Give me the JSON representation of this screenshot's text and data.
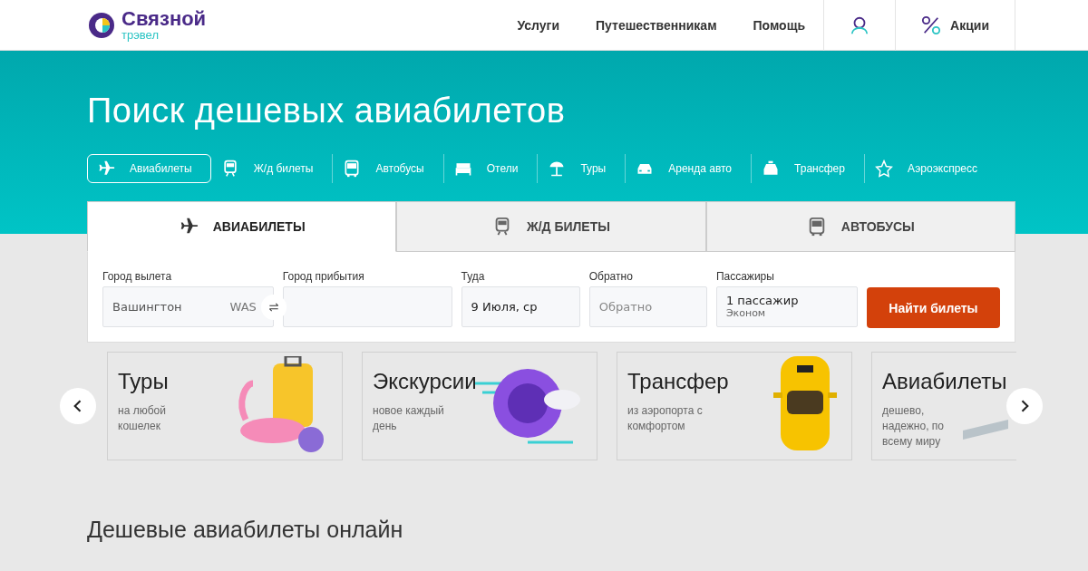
{
  "header": {
    "logo": {
      "name": "Связной",
      "sub": "трэвел"
    },
    "nav": [
      "Услуги",
      "Путешественникам",
      "Помощь"
    ],
    "promo": "Акции"
  },
  "hero": {
    "title": "Поиск дешевых авиабилетов"
  },
  "categories": [
    {
      "label": "Авиабилеты",
      "selected": true
    },
    {
      "label": "Ж/д билеты",
      "selected": false
    },
    {
      "label": "Автобусы",
      "selected": false
    },
    {
      "label": "Отели",
      "selected": false
    },
    {
      "label": "Туры",
      "selected": false
    },
    {
      "label": "Аренда авто",
      "selected": false
    },
    {
      "label": "Трансфер",
      "selected": false
    },
    {
      "label": "Аэроэкспресс",
      "selected": false
    }
  ],
  "search_tabs": [
    {
      "label": "АВИАБИЛЕТЫ",
      "selected": true
    },
    {
      "label": "Ж/Д БИЛЕТЫ",
      "selected": false
    },
    {
      "label": "АВТОБУСЫ",
      "selected": false
    }
  ],
  "form": {
    "fields": [
      {
        "kind": "city",
        "label": "Город вылета",
        "value": "Вашингтон",
        "code": "WAS"
      },
      {
        "kind": "city",
        "label": "Город прибытия"
      },
      {
        "kind": "date",
        "label": "Туда",
        "value": "9 Июля, ср"
      },
      {
        "kind": "date",
        "label": "Обратно",
        "placeholder": "Обратно"
      },
      {
        "kind": "passengers",
        "label": "Пассажиры",
        "value": "1 пассажир",
        "sub": "Эконом"
      }
    ],
    "button": "Найти билеты"
  },
  "cards": [
    {
      "title": "Туры",
      "text": "на любой кошелек"
    },
    {
      "title": "Экскурсии",
      "text": "новое каждый день"
    },
    {
      "title": "Трансфер",
      "text": "из аэропорта с комфортом"
    },
    {
      "title": "Авиабилеты",
      "text": "дешево, надежно, по всему миру"
    }
  ],
  "section_title": "Дешевые авиабилеты онлайн"
}
